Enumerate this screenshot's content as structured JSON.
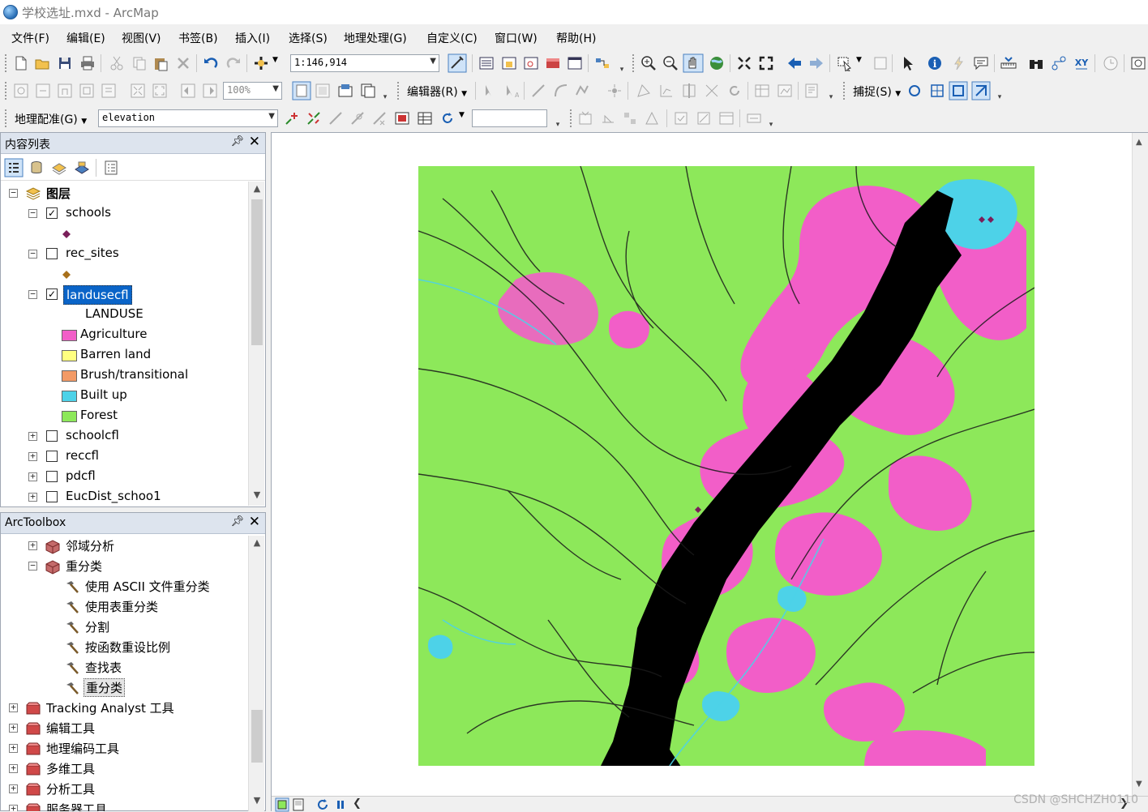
{
  "window": {
    "title": "学校选址.mxd - ArcMap"
  },
  "menu": [
    "文件(F)",
    "编辑(E)",
    "视图(V)",
    "书签(B)",
    "插入(I)",
    "选择(S)",
    "地理处理(G)",
    "自定义(C)",
    "窗口(W)",
    "帮助(H)"
  ],
  "toolbar": {
    "scale": "1:146,914",
    "zoom_percent": "100%",
    "editor_label": "编辑器(R)",
    "snapping_label": "捕捉(S)",
    "georef_label": "地理配准(G)",
    "georef_layer": "elevation",
    "georef_text": ""
  },
  "toc": {
    "title": "内容列表",
    "root_label": "图层",
    "layers": {
      "schools": "schools",
      "rec_sites": "rec_sites",
      "landusecfl": "landusecfl",
      "landuse_field": "LANDUSE",
      "schoolcfl": "schoolcfl",
      "reccfl": "reccfl",
      "pdcfl": "pdcfl",
      "eucdist": "EucDist_schoo1"
    },
    "legend": [
      {
        "label": "Agriculture",
        "color": "#f25ec8"
      },
      {
        "label": "Barren land",
        "color": "#ffff80"
      },
      {
        "label": "Brush/transitional",
        "color": "#f29a66"
      },
      {
        "label": "Built up",
        "color": "#4dd2e8"
      },
      {
        "label": "Forest",
        "color": "#8de85a"
      }
    ]
  },
  "toolbox": {
    "title": "ArcToolbox",
    "items": {
      "neighborhood": "邻域分析",
      "reclass": "重分类",
      "tool_ascii": "使用 ASCII 文件重分类",
      "tool_table": "使用表重分类",
      "tool_slice": "分割",
      "tool_rescale": "按函数重设比例",
      "tool_lookup": "查找表",
      "tool_reclassify": "重分类",
      "tracking": "Tracking Analyst 工具",
      "editing": "编辑工具",
      "geocoding": "地理编码工具",
      "threed": "多维工具",
      "analysis": "分析工具",
      "server": "服务器工具"
    }
  },
  "watermark": "CSDN @SHCHZH0110",
  "colors": {
    "forest": "#8de85a",
    "agriculture": "#f25ec8",
    "builtup": "#4dd2e8",
    "water": "#000000",
    "selection": "#0a64c8"
  }
}
